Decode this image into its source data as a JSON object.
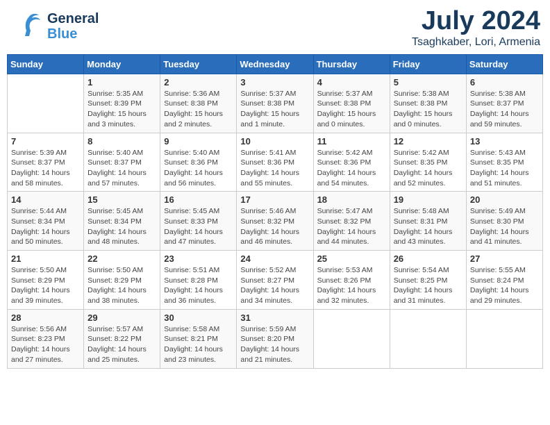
{
  "header": {
    "logo_general": "General",
    "logo_blue": "Blue",
    "month_year": "July 2024",
    "location": "Tsaghkaber, Lori, Armenia"
  },
  "weekdays": [
    "Sunday",
    "Monday",
    "Tuesday",
    "Wednesday",
    "Thursday",
    "Friday",
    "Saturday"
  ],
  "weeks": [
    [
      {
        "day": "",
        "info": ""
      },
      {
        "day": "1",
        "info": "Sunrise: 5:35 AM\nSunset: 8:39 PM\nDaylight: 15 hours\nand 3 minutes."
      },
      {
        "day": "2",
        "info": "Sunrise: 5:36 AM\nSunset: 8:38 PM\nDaylight: 15 hours\nand 2 minutes."
      },
      {
        "day": "3",
        "info": "Sunrise: 5:37 AM\nSunset: 8:38 PM\nDaylight: 15 hours\nand 1 minute."
      },
      {
        "day": "4",
        "info": "Sunrise: 5:37 AM\nSunset: 8:38 PM\nDaylight: 15 hours\nand 0 minutes."
      },
      {
        "day": "5",
        "info": "Sunrise: 5:38 AM\nSunset: 8:38 PM\nDaylight: 15 hours\nand 0 minutes."
      },
      {
        "day": "6",
        "info": "Sunrise: 5:38 AM\nSunset: 8:37 PM\nDaylight: 14 hours\nand 59 minutes."
      }
    ],
    [
      {
        "day": "7",
        "info": "Sunrise: 5:39 AM\nSunset: 8:37 PM\nDaylight: 14 hours\nand 58 minutes."
      },
      {
        "day": "8",
        "info": "Sunrise: 5:40 AM\nSunset: 8:37 PM\nDaylight: 14 hours\nand 57 minutes."
      },
      {
        "day": "9",
        "info": "Sunrise: 5:40 AM\nSunset: 8:36 PM\nDaylight: 14 hours\nand 56 minutes."
      },
      {
        "day": "10",
        "info": "Sunrise: 5:41 AM\nSunset: 8:36 PM\nDaylight: 14 hours\nand 55 minutes."
      },
      {
        "day": "11",
        "info": "Sunrise: 5:42 AM\nSunset: 8:36 PM\nDaylight: 14 hours\nand 54 minutes."
      },
      {
        "day": "12",
        "info": "Sunrise: 5:42 AM\nSunset: 8:35 PM\nDaylight: 14 hours\nand 52 minutes."
      },
      {
        "day": "13",
        "info": "Sunrise: 5:43 AM\nSunset: 8:35 PM\nDaylight: 14 hours\nand 51 minutes."
      }
    ],
    [
      {
        "day": "14",
        "info": "Sunrise: 5:44 AM\nSunset: 8:34 PM\nDaylight: 14 hours\nand 50 minutes."
      },
      {
        "day": "15",
        "info": "Sunrise: 5:45 AM\nSunset: 8:34 PM\nDaylight: 14 hours\nand 48 minutes."
      },
      {
        "day": "16",
        "info": "Sunrise: 5:45 AM\nSunset: 8:33 PM\nDaylight: 14 hours\nand 47 minutes."
      },
      {
        "day": "17",
        "info": "Sunrise: 5:46 AM\nSunset: 8:32 PM\nDaylight: 14 hours\nand 46 minutes."
      },
      {
        "day": "18",
        "info": "Sunrise: 5:47 AM\nSunset: 8:32 PM\nDaylight: 14 hours\nand 44 minutes."
      },
      {
        "day": "19",
        "info": "Sunrise: 5:48 AM\nSunset: 8:31 PM\nDaylight: 14 hours\nand 43 minutes."
      },
      {
        "day": "20",
        "info": "Sunrise: 5:49 AM\nSunset: 8:30 PM\nDaylight: 14 hours\nand 41 minutes."
      }
    ],
    [
      {
        "day": "21",
        "info": "Sunrise: 5:50 AM\nSunset: 8:29 PM\nDaylight: 14 hours\nand 39 minutes."
      },
      {
        "day": "22",
        "info": "Sunrise: 5:50 AM\nSunset: 8:29 PM\nDaylight: 14 hours\nand 38 minutes."
      },
      {
        "day": "23",
        "info": "Sunrise: 5:51 AM\nSunset: 8:28 PM\nDaylight: 14 hours\nand 36 minutes."
      },
      {
        "day": "24",
        "info": "Sunrise: 5:52 AM\nSunset: 8:27 PM\nDaylight: 14 hours\nand 34 minutes."
      },
      {
        "day": "25",
        "info": "Sunrise: 5:53 AM\nSunset: 8:26 PM\nDaylight: 14 hours\nand 32 minutes."
      },
      {
        "day": "26",
        "info": "Sunrise: 5:54 AM\nSunset: 8:25 PM\nDaylight: 14 hours\nand 31 minutes."
      },
      {
        "day": "27",
        "info": "Sunrise: 5:55 AM\nSunset: 8:24 PM\nDaylight: 14 hours\nand 29 minutes."
      }
    ],
    [
      {
        "day": "28",
        "info": "Sunrise: 5:56 AM\nSunset: 8:23 PM\nDaylight: 14 hours\nand 27 minutes."
      },
      {
        "day": "29",
        "info": "Sunrise: 5:57 AM\nSunset: 8:22 PM\nDaylight: 14 hours\nand 25 minutes."
      },
      {
        "day": "30",
        "info": "Sunrise: 5:58 AM\nSunset: 8:21 PM\nDaylight: 14 hours\nand 23 minutes."
      },
      {
        "day": "31",
        "info": "Sunrise: 5:59 AM\nSunset: 8:20 PM\nDaylight: 14 hours\nand 21 minutes."
      },
      {
        "day": "",
        "info": ""
      },
      {
        "day": "",
        "info": ""
      },
      {
        "day": "",
        "info": ""
      }
    ]
  ]
}
